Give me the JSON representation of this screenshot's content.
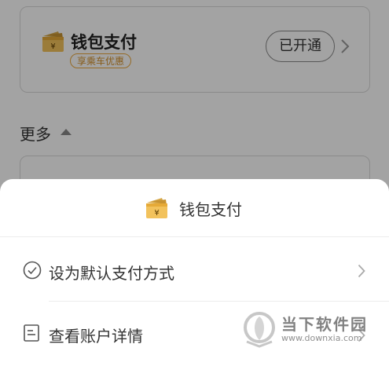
{
  "background": {
    "wallet_card": {
      "title": "钱包支付",
      "badge": "享乘车优惠",
      "status_button": "已开通"
    },
    "more_label": "更多"
  },
  "sheet": {
    "title": "钱包支付",
    "items": [
      {
        "label": "设为默认支付方式",
        "icon": "check-circle-icon"
      },
      {
        "label": "查看账户详情",
        "icon": "document-icon"
      }
    ]
  },
  "watermark": {
    "name": "当下软件园",
    "url": "www.downxia.com"
  },
  "colors": {
    "accent_gold": "#e9a73c",
    "overlay": "rgba(0,0,0,0.36)",
    "text": "#333333"
  }
}
